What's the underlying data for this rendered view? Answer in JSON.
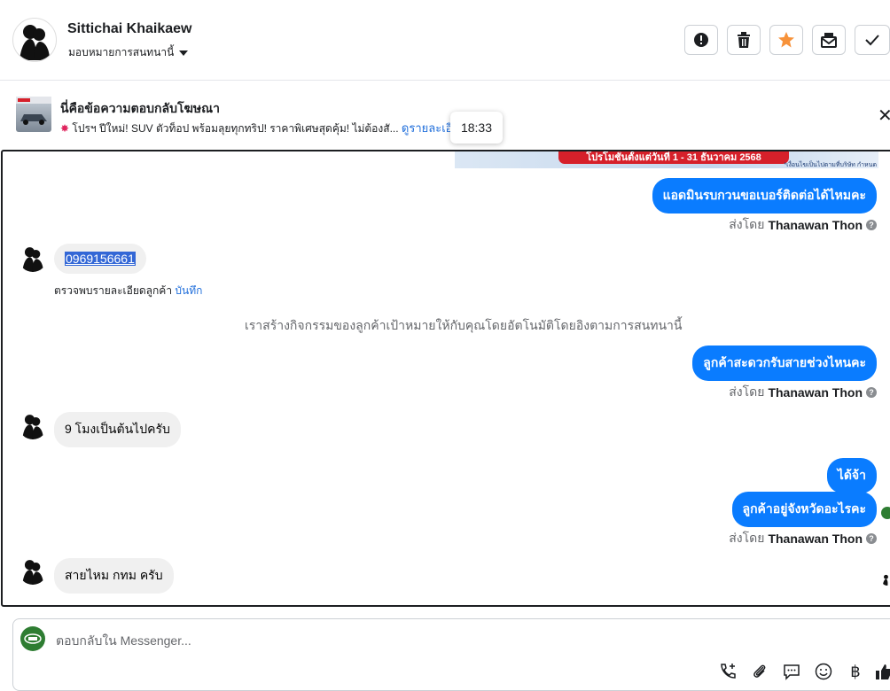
{
  "header": {
    "contact_name": "Sittichai Khaikaew",
    "assign_label": "มอบหมายการสนทนานี้",
    "actions": [
      "alert-icon",
      "trash-icon",
      "star-icon",
      "mark-unread-icon",
      "check-icon"
    ],
    "accent_star": "#f7923a"
  },
  "ad_reply": {
    "title": "นี่คือข้อความตอบกลับโฆษณา",
    "text": "โปรฯ ปีใหม่! SUV ตัวท็อป พร้อมลุยทุกทริป! ราคาพิเศษสุดคุ้ม! ไม่ต้องสั...",
    "link": "ดูรายละเอีย"
  },
  "tooltip": {
    "time": "18:33"
  },
  "banner": {
    "promo": "โปรโมชั่นตั้งแต่วันที่ 1 - 31 ธันวาคม 2568",
    "note": "*เงื่อนไขเป็นไปตามที่บริษัท กำหนด"
  },
  "messages": {
    "m1": "แอดมินรบกวนขอเบอร์ติดต่อได้ไหมคะ",
    "sent_prefix": "ส่งโดย",
    "sent_agent": "Thanawan Thon",
    "phone": "0969156661",
    "detect_text": "ตรวจพบรายละเอียดลูกค้า",
    "detect_action": "บันทึก",
    "system": "เราสร้างกิจกรรมของลูกค้าเป้าหมายให้กับคุณโดยอัตโนมัติโดยอิงตามการสนทนานี้",
    "m2": "ลูกค้าสะดวกรับสายช่วงไหนคะ",
    "r2": "9 โมงเป็นต้นไปครับ",
    "m3": "ได้จ้า",
    "m4": "ลูกค้าอยู่จังหวัดอะไรคะ",
    "r3": "สายไหม กทม ครับ"
  },
  "composer": {
    "placeholder": "ตอบกลับใน Messenger...",
    "icons": [
      "phone-plus-icon",
      "attach-icon",
      "message-icon",
      "emoji-icon",
      "baht-icon",
      "thumbs-up-icon"
    ]
  },
  "colors": {
    "outgoing": "#0a7cff",
    "incoming": "#f0f0f0",
    "link": "#216fdb"
  }
}
